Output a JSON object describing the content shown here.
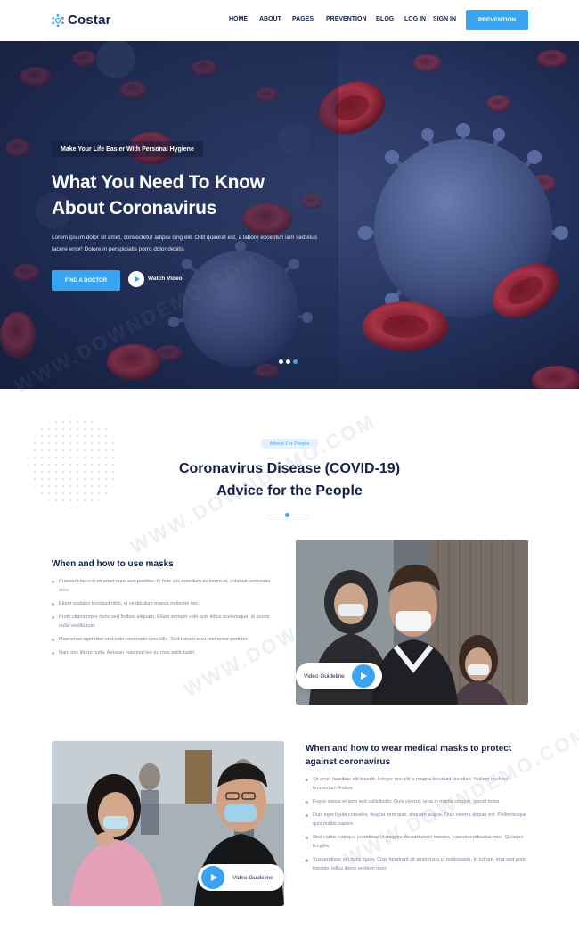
{
  "brand": {
    "name": "Costar",
    "accent": "#3aa4f3",
    "navy": "#14204a"
  },
  "nav": {
    "items": [
      "HOME",
      "ABOUT",
      "PAGES",
      "PREVENTION",
      "BLOG"
    ],
    "login": "LOG IN",
    "separator": "/",
    "signin": "SIGN IN",
    "cta": "PREVENTION"
  },
  "hero": {
    "tag": "Make Your Life Easier With Personal Hygiene",
    "title_line1": "What You Need To Know",
    "title_line2": "About Coronavirus",
    "description": "Lorem ipsum dolor sit amet, consectetur adipisi cing elit. Odit quaerat est, a labore excepturi iam sed eius facere error! Dolore in perspiciatis porro dolor debitis",
    "primary_button": "FIND A DOCTOR",
    "video_link": "Watch Video",
    "slides": 3,
    "active_slide": 3
  },
  "advice": {
    "badge": "Advice For People",
    "title_line1": "Coronavirus Disease (COVID-19)",
    "title_line2": "Advice for the People"
  },
  "block1": {
    "title": "When and how to use masks",
    "bullets": [
      "Praesent laoreet sit amet nunc sed porttitor. In felis est, interdum ac lorem ut, volutpat venenatis ares",
      "Etiam sodales tincidunt nibh, at vestibulum massa molestie nec.",
      "Proin ullamcorper nunc sed finibus aliquam. Etiam semper velit quis tellus scelerisque, id auctor nulla vestibulum.",
      "Maecenas eget nibh sed odio commodo convallis. Sed rutrum arcu non tortor porttitor",
      "Nam nec libero nulla. Aenean euismod leo eu mos sollicitudin"
    ],
    "video_label": "Video Guideline"
  },
  "block2": {
    "title_line1": "When and how to wear medical masks to protect",
    "title_line2": "against coronavirus",
    "bullets": [
      "Sit amet faucibus elit blandit. Integer non elit a magna tincidunt tincidunt. Nullam eleifend fermentum finibus.",
      "Fusce varius et sem sed sollicitudin. Duis viverra, urna in mattis congue, ipsum tortor",
      "Duis eget ligula convallis, feugiat sem quis, aliquam augue. Duis viverra aliquet est. Pellentesque quis mattis sapien.",
      "Orci varius natoque penatibus et magnis dis parturient montes, nascetur ridiculus mus. Quisque fringilla.",
      "Suspendisse vel nunc ligula. Cras hendrerit sit amet risus ut malesuada. In rutrum, erat sed porta lobortis, tellus libero pretium nunc"
    ],
    "video_label": "Video Guideline"
  },
  "watermark": "WWW.DOWNDEMO.COM"
}
